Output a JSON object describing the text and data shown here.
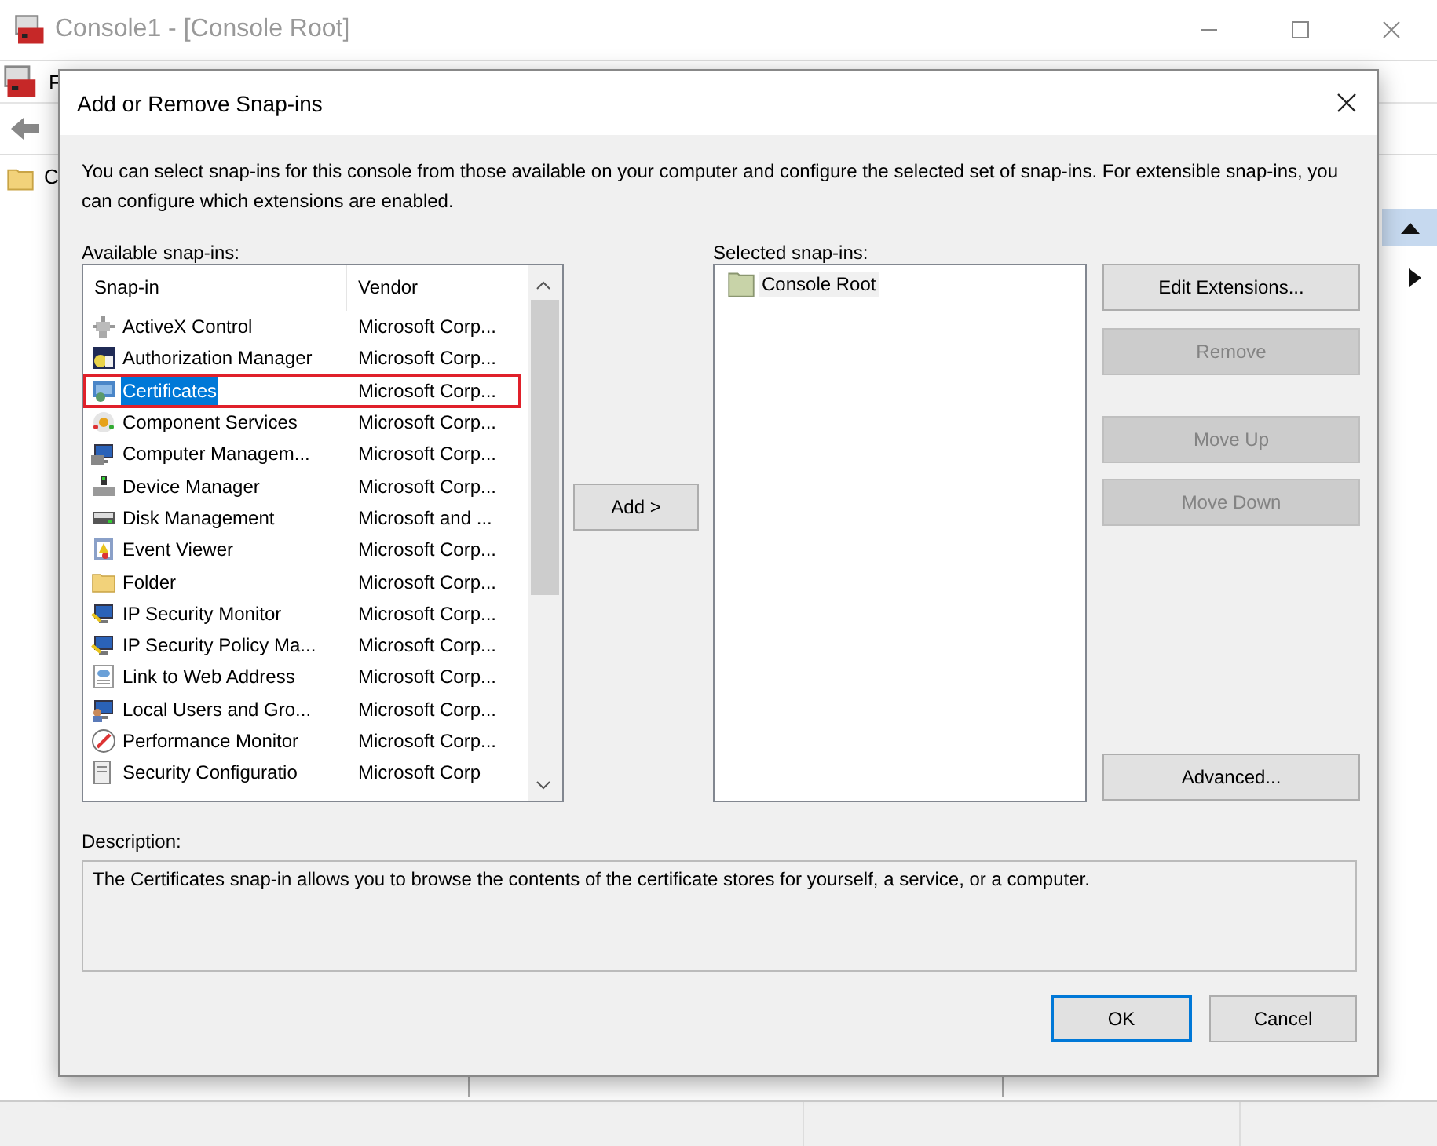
{
  "window": {
    "title": "Console1 - [Console Root]",
    "menu_fragment": "F",
    "tree_fragment": "C"
  },
  "dialog": {
    "title": "Add or Remove Snap-ins",
    "intro": "You can select snap-ins for this console from those available on your computer and configure the selected set of snap-ins. For extensible snap-ins, you can configure which extensions are enabled.",
    "available": {
      "label": "Available snap-ins:",
      "columns": [
        "Snap-in",
        "Vendor"
      ],
      "rows": [
        {
          "name": "ActiveX Control",
          "vendor": "Microsoft Corp...",
          "selected": false,
          "outlined": false
        },
        {
          "name": "Authorization Manager",
          "vendor": "Microsoft Corp...",
          "selected": false,
          "outlined": false
        },
        {
          "name": "Certificates",
          "vendor": "Microsoft Corp...",
          "selected": true,
          "outlined": true
        },
        {
          "name": "Component Services",
          "vendor": "Microsoft Corp...",
          "selected": false,
          "outlined": false
        },
        {
          "name": "Computer Managem...",
          "vendor": "Microsoft Corp...",
          "selected": false,
          "outlined": false
        },
        {
          "name": "Device Manager",
          "vendor": "Microsoft Corp...",
          "selected": false,
          "outlined": false
        },
        {
          "name": "Disk Management",
          "vendor": "Microsoft and ...",
          "selected": false,
          "outlined": false
        },
        {
          "name": "Event Viewer",
          "vendor": "Microsoft Corp...",
          "selected": false,
          "outlined": false
        },
        {
          "name": "Folder",
          "vendor": "Microsoft Corp...",
          "selected": false,
          "outlined": false
        },
        {
          "name": "IP Security Monitor",
          "vendor": "Microsoft Corp...",
          "selected": false,
          "outlined": false
        },
        {
          "name": "IP Security Policy Ma...",
          "vendor": "Microsoft Corp...",
          "selected": false,
          "outlined": false
        },
        {
          "name": "Link to Web Address",
          "vendor": "Microsoft Corp...",
          "selected": false,
          "outlined": false
        },
        {
          "name": "Local Users and Gro...",
          "vendor": "Microsoft Corp...",
          "selected": false,
          "outlined": false
        },
        {
          "name": "Performance Monitor",
          "vendor": "Microsoft Corp...",
          "selected": false,
          "outlined": false
        },
        {
          "name": "Security Configuratio",
          "vendor": "Microsoft Corp",
          "selected": false,
          "outlined": false
        }
      ]
    },
    "add_button": "Add >",
    "selected": {
      "label": "Selected snap-ins:",
      "items": [
        {
          "name": "Console Root"
        }
      ]
    },
    "side_buttons": [
      {
        "label": "Edit Extensions...",
        "disabled": false
      },
      {
        "label": "Remove",
        "disabled": true
      },
      {
        "label": "Move Up",
        "disabled": true
      },
      {
        "label": "Move Down",
        "disabled": true
      },
      {
        "label": "Advanced...",
        "disabled": false
      }
    ],
    "description": {
      "label": "Description:",
      "text": "The Certificates snap-in allows you to browse the contents of the certificate stores for yourself, a service, or a computer."
    },
    "buttons": [
      {
        "label": "OK",
        "default": true
      },
      {
        "label": "Cancel",
        "default": false
      }
    ]
  }
}
